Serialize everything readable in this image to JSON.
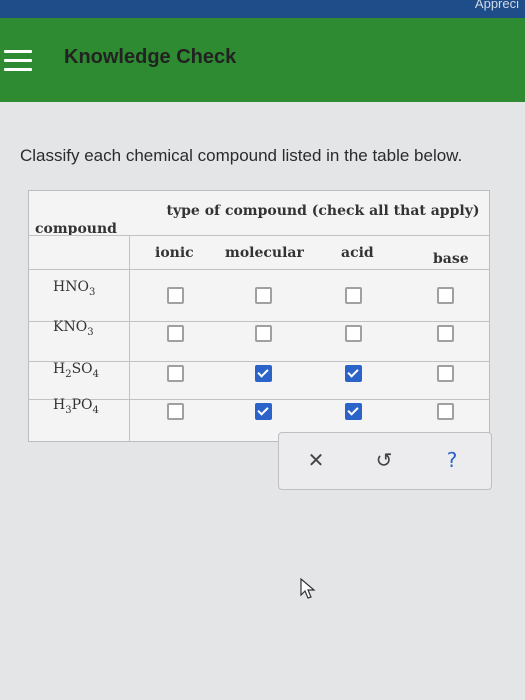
{
  "top_strip": {
    "text": "Appreci"
  },
  "header": {
    "title": "Knowledge Check"
  },
  "prompt": "Classify each chemical compound listed in the table below.",
  "table": {
    "group_header": "type of compound (check all that apply)",
    "compound_header": "compound",
    "columns": [
      "ionic",
      "molecular",
      "acid",
      "base"
    ],
    "rows": [
      {
        "parts": [
          "HNO",
          "3",
          ""
        ],
        "checks": [
          false,
          false,
          false,
          false
        ]
      },
      {
        "parts": [
          "KNO",
          "3",
          ""
        ],
        "checks": [
          false,
          false,
          false,
          false
        ]
      },
      {
        "parts": [
          "H",
          "2",
          "SO",
          "4"
        ],
        "checks": [
          false,
          true,
          true,
          false
        ]
      },
      {
        "parts": [
          "H",
          "3",
          "PO",
          "4"
        ],
        "checks": [
          false,
          true,
          true,
          false
        ]
      }
    ]
  },
  "toolbar": {
    "clear_icon": "close-icon",
    "clear_glyph": "✕",
    "undo_icon": "undo-icon",
    "undo_glyph": "↺",
    "help_icon": "help-icon",
    "help_glyph": "?"
  },
  "colors": {
    "header_green": "#2e8b32",
    "check_blue": "#2c63c9",
    "top_strip_blue": "#1f4d8a"
  }
}
